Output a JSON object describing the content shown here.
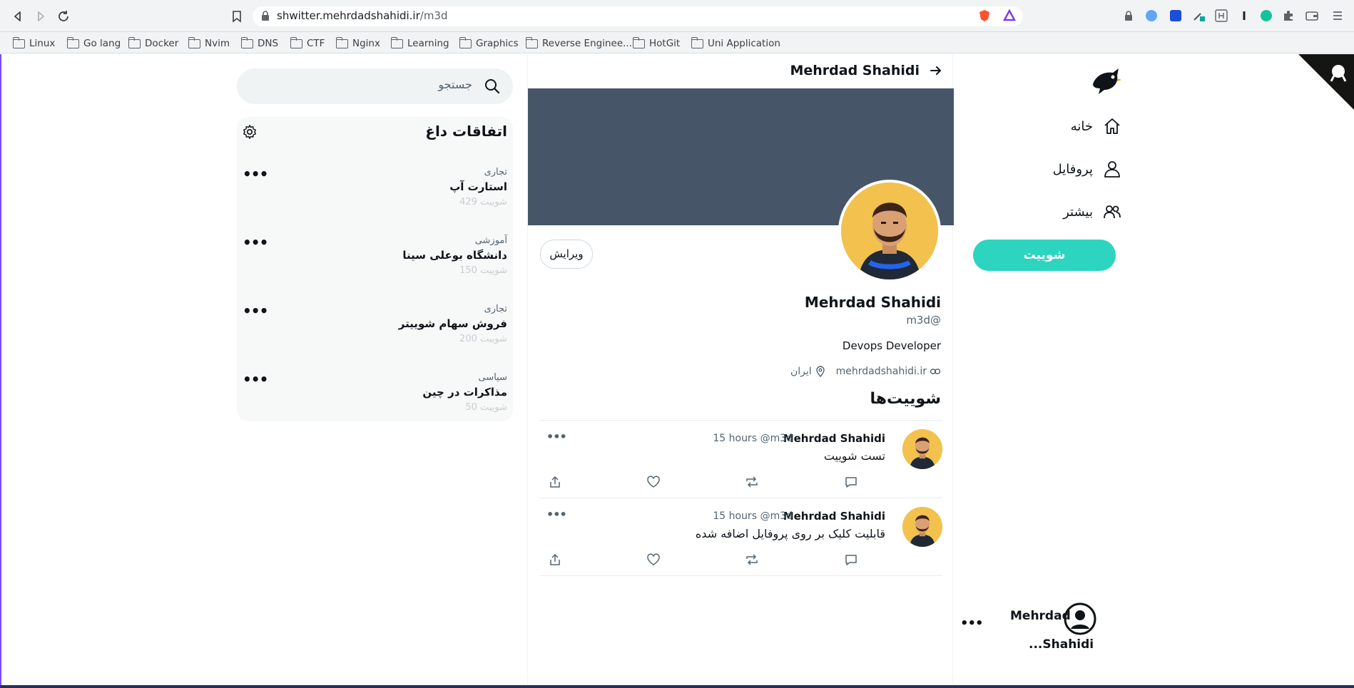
{
  "browser": {
    "url_host": "shwitter.mehrdadshahidi.ir",
    "url_path": "/m3d",
    "bookmarks": [
      "Linux",
      "Go lang",
      "Docker",
      "Nvim",
      "DNS",
      "CTF",
      "Nginx",
      "Learning",
      "Graphics",
      "Reverse Enginee...",
      "HotGit",
      "Uni Application"
    ]
  },
  "search": {
    "placeholder": "جستجو"
  },
  "trends": {
    "title": "اتفاقات داغ",
    "items": [
      {
        "category": "تجاری",
        "name": "استارت آپ",
        "count": "429 شوییت"
      },
      {
        "category": "آموزشی",
        "name": "دانشگاه بوعلی سینا",
        "count": "150 شوییت"
      },
      {
        "category": "تجاری",
        "name": "فروش سهام شوییتر",
        "count": "200 شوییت"
      },
      {
        "category": "سیاسی",
        "name": "مذاکرات در چین",
        "count": "50 شوییت"
      }
    ]
  },
  "profile": {
    "header_name": "Mehrdad Shahidi",
    "edit_label": "ویرایش",
    "name": "Mehrdad Shahidi",
    "handle": "m3d@",
    "bio": "Devops Developer",
    "location": "ایران",
    "website": "mehrdadshahidi.ir"
  },
  "tweets_title": "شوییت‌ها",
  "tweets": [
    {
      "name": "Mehrdad Shahidi",
      "handle": "@m3d",
      "time": "15 hours",
      "text": "تست شوییت"
    },
    {
      "name": "Mehrdad Shahidi",
      "handle": "@m3d",
      "time": "15 hours",
      "text": "قابلیت کلیک بر روی پروفایل اضافه شده"
    }
  ],
  "nav": {
    "items": [
      {
        "label": "خانه",
        "icon": "home-icon"
      },
      {
        "label": "پروفایل",
        "icon": "user-icon"
      },
      {
        "label": "بیشتر",
        "icon": "users-icon"
      }
    ],
    "tweet_button": "شوییت",
    "account_first": "Mehrdad",
    "account_last": "...Shahidi"
  },
  "colors": {
    "accent": "#2dd4bf",
    "banner": "#475569",
    "page_border": "#7c4dff"
  }
}
